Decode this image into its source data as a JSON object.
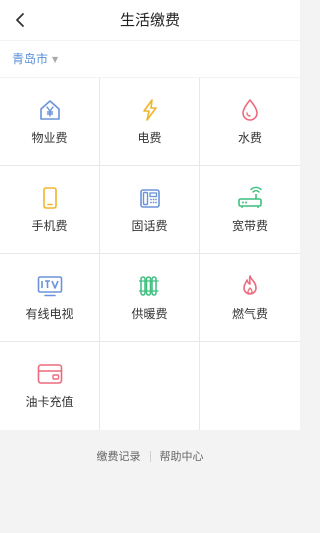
{
  "header": {
    "title": "生活缴费",
    "back_icon": "back-arrow-icon"
  },
  "location": {
    "city": "青岛市",
    "caret": "▼"
  },
  "services": [
    {
      "id": "property",
      "label": "物业费",
      "icon": "property-fee-icon",
      "color": "#6b93d9"
    },
    {
      "id": "electric",
      "label": "电费",
      "icon": "lightning-icon",
      "color": "#f0b62b"
    },
    {
      "id": "water",
      "label": "水费",
      "icon": "water-drop-icon",
      "color": "#ec6b7d"
    },
    {
      "id": "mobile",
      "label": "手机费",
      "icon": "mobile-phone-icon",
      "color": "#f0b62b"
    },
    {
      "id": "landline",
      "label": "固话费",
      "icon": "landline-phone-icon",
      "color": "#6b93d9"
    },
    {
      "id": "broadband",
      "label": "宽带费",
      "icon": "router-icon",
      "color": "#3fbf7f"
    },
    {
      "id": "cabletv",
      "label": "有线电视",
      "icon": "tv-icon",
      "color": "#6b93d9"
    },
    {
      "id": "heating",
      "label": "供暖费",
      "icon": "radiator-icon",
      "color": "#3fbf7f"
    },
    {
      "id": "gas",
      "label": "燃气费",
      "icon": "flame-icon",
      "color": "#ec6b7d"
    },
    {
      "id": "fuelcard",
      "label": "油卡充值",
      "icon": "card-icon",
      "color": "#ec6b7d"
    }
  ],
  "footer": {
    "records": "缴费记录",
    "help": "帮助中心"
  }
}
